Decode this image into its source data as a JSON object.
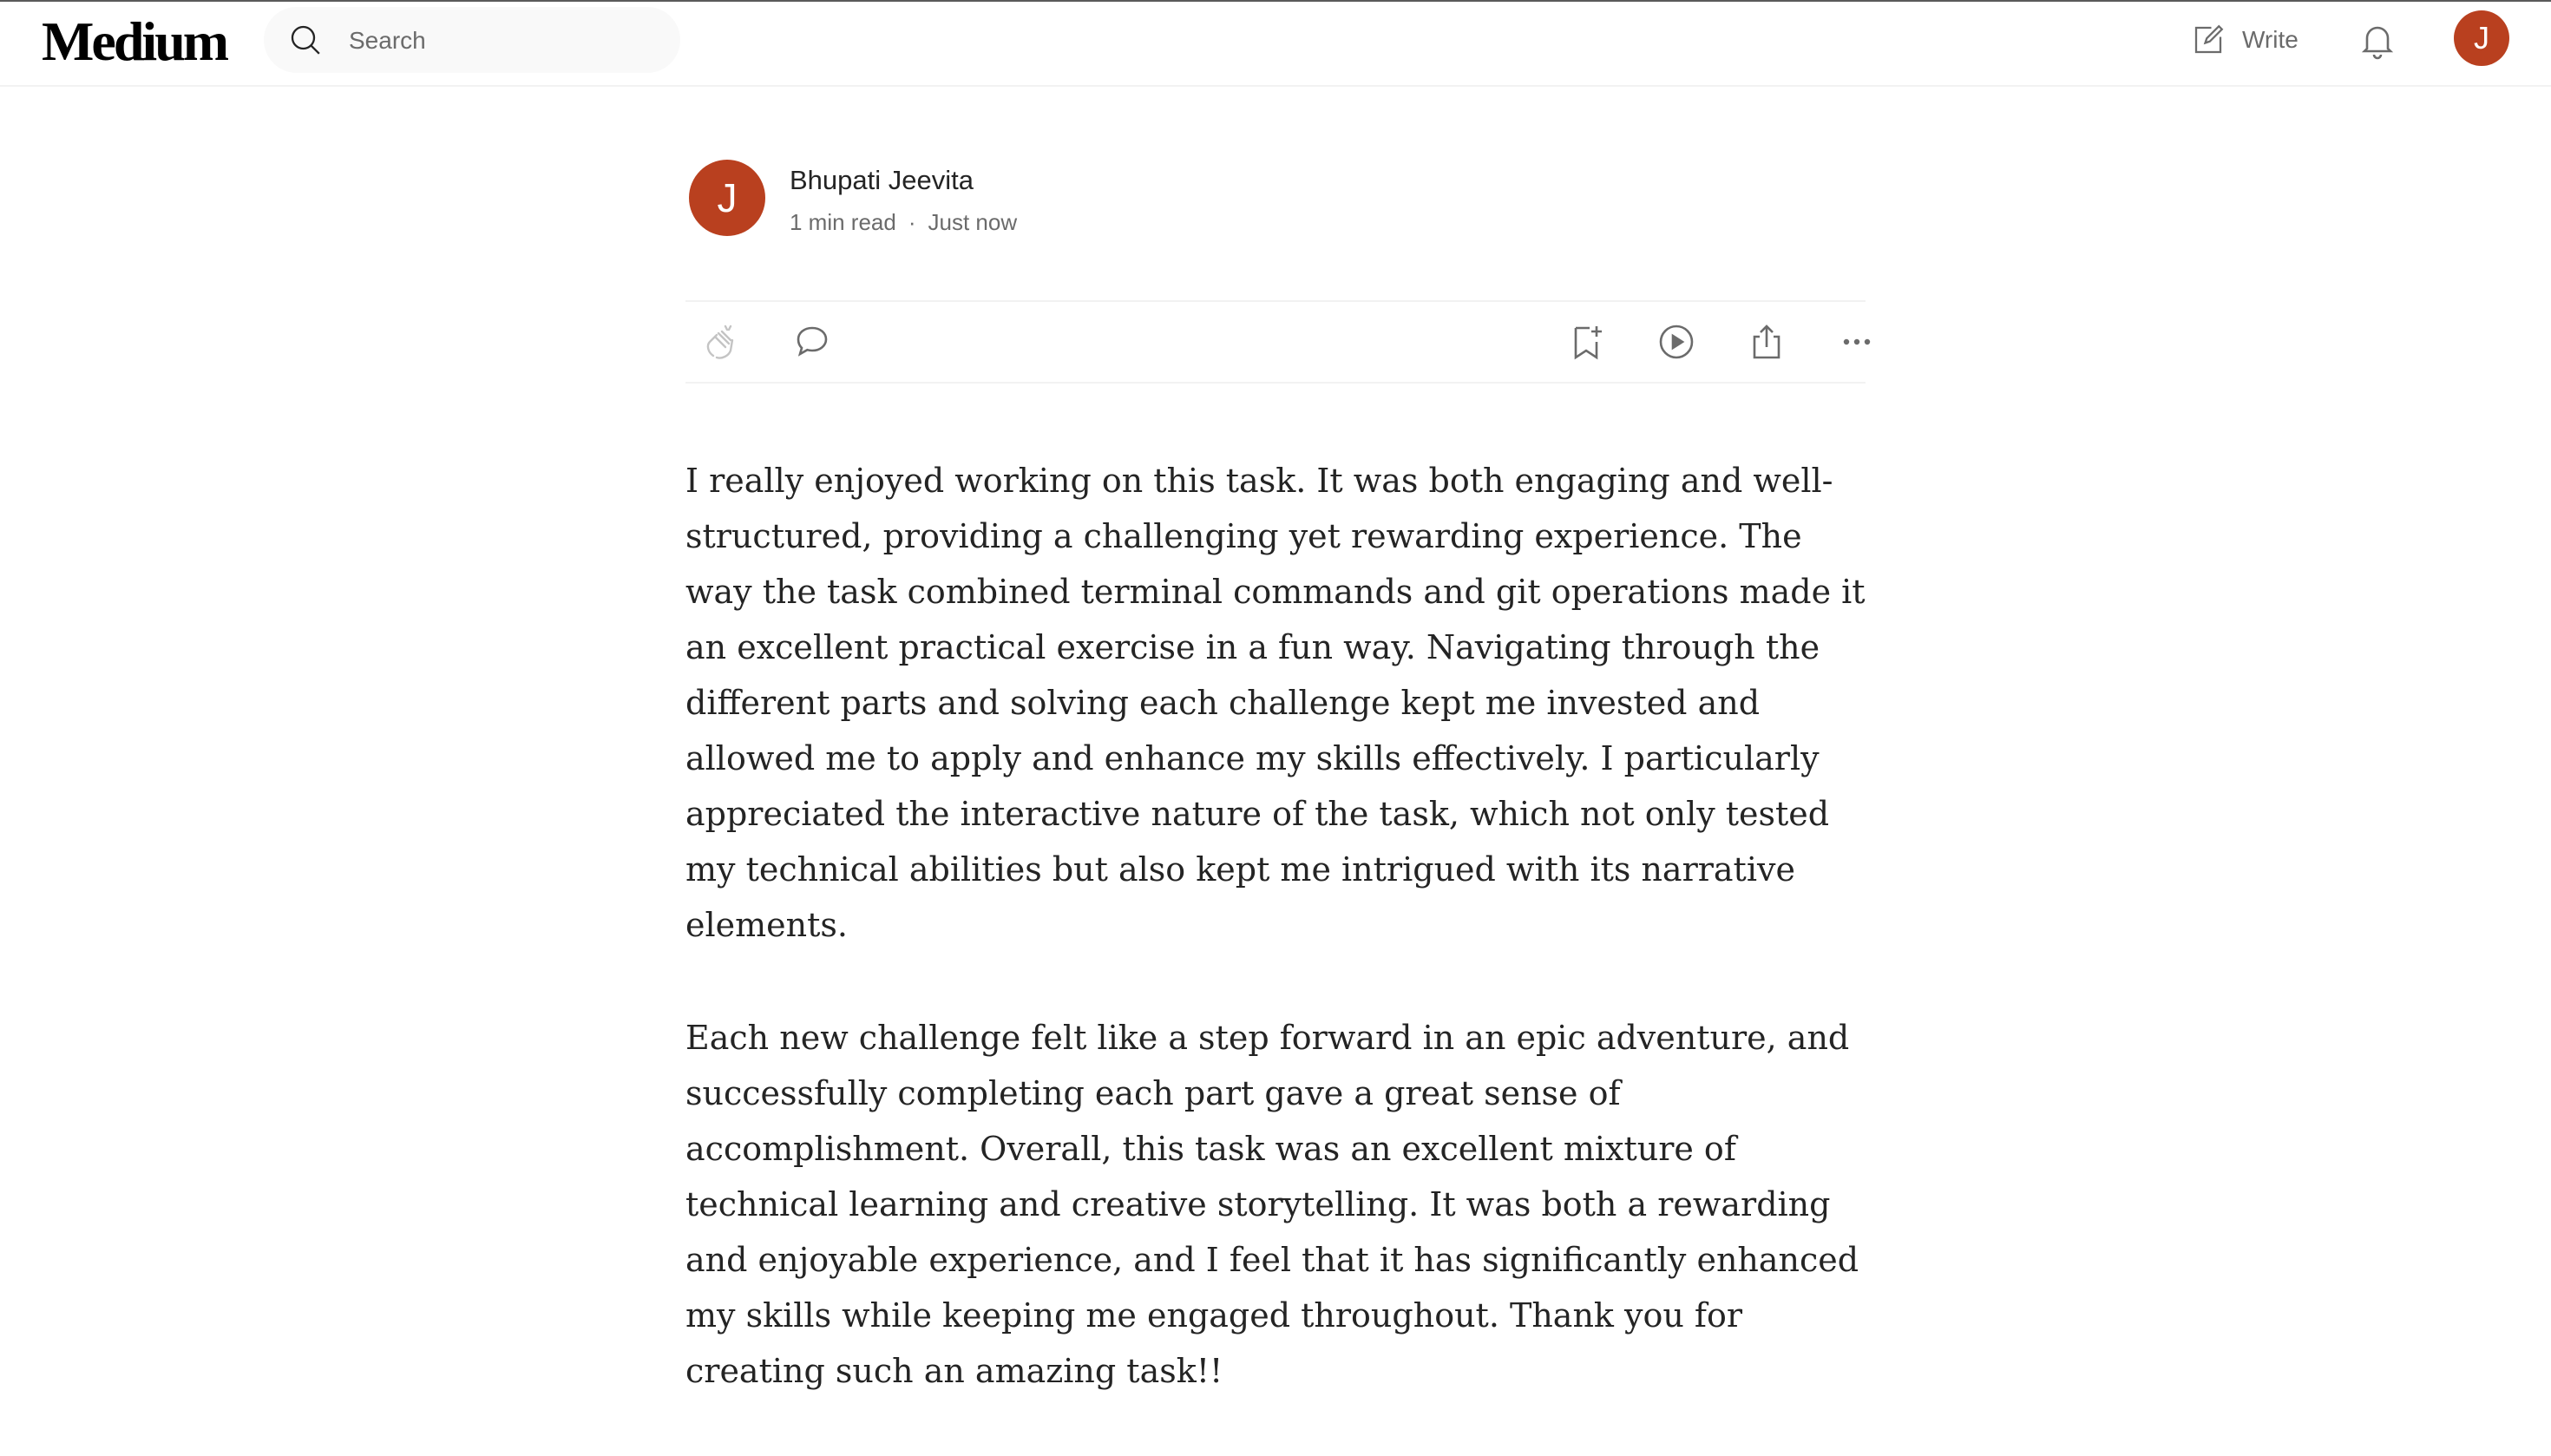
{
  "header": {
    "logo": "Medium",
    "search_placeholder": "Search",
    "write_label": "Write",
    "user_initial": "J"
  },
  "author": {
    "initial": "J",
    "name": "Bhupati Jeevita",
    "read_time": "1 min read",
    "separator": "·",
    "published": "Just now"
  },
  "actions": {
    "icons": [
      "clap-icon",
      "comment-icon",
      "bookmark-add-icon",
      "play-icon",
      "share-icon",
      "more-icon"
    ]
  },
  "article": {
    "paragraphs": [
      "I really enjoyed working on this task. It was both engaging and well-structured, providing a challenging yet rewarding experience. The way the task combined terminal commands and git operations made it an excellent practical exercise in a fun way. Navigating through the different parts and solving each challenge kept me invested and allowed me to apply and enhance my skills effectively. I particularly appreciated the interactive nature of the task, which not only tested my technical abilities but also kept me intrigued with its narrative elements.",
      "Each new challenge felt like a step forward in an epic adventure, and successfully completing each part gave a great sense of accomplishment. Overall, this task was an excellent mixture of technical learning and creative storytelling. It was both a rewarding and enjoyable experience, and I feel that it has significantly enhanced my skills while keeping me engaged throughout. Thank you for creating such an amazing task!!"
    ]
  },
  "colors": {
    "avatar_bg": "#b9401f",
    "muted_text": "#6b6b6b",
    "body_text": "#242424"
  }
}
